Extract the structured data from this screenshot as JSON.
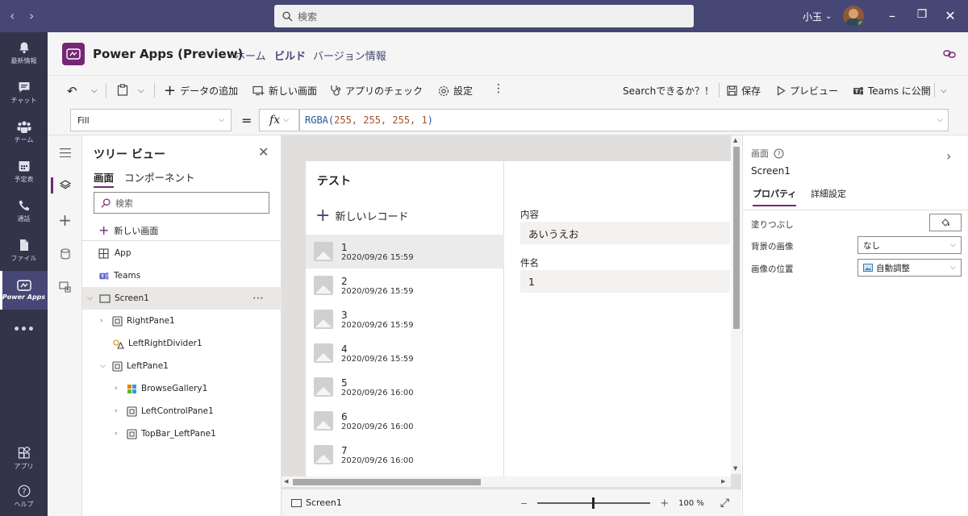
{
  "topbar": {
    "search_placeholder": "検索",
    "user_name": "小玉",
    "user_chevron": "⌄"
  },
  "rail": {
    "items": [
      {
        "label": "最新情報",
        "icon": "bell-icon"
      },
      {
        "label": "チャット",
        "icon": "chat-icon"
      },
      {
        "label": "チーム",
        "icon": "teams-icon"
      },
      {
        "label": "予定表",
        "icon": "calendar-icon"
      },
      {
        "label": "通話",
        "icon": "phone-icon"
      },
      {
        "label": "ファイル",
        "icon": "file-icon"
      },
      {
        "label": "Power Apps",
        "icon": "powerapps-icon"
      },
      {
        "label": "アプリ",
        "icon": "apps-icon"
      },
      {
        "label": "ヘルプ",
        "icon": "help-icon"
      }
    ]
  },
  "app": {
    "title": "Power Apps (Preview)",
    "tabs": [
      "ホーム",
      "ビルド",
      "バージョン情報"
    ]
  },
  "commands": {
    "add_data": "データの追加",
    "new_screen": "新しい画面",
    "app_check": "アプリのチェック",
    "settings": "設定",
    "search_q": "Searchできるか？！",
    "save": "保存",
    "preview": "プレビュー",
    "publish": "Teams に公開"
  },
  "formula": {
    "property": "Fill",
    "eq": "=",
    "fx": "fx",
    "fn": "RGBA(",
    "args": "255, 255, 255, 1",
    "close": ")"
  },
  "tree": {
    "title": "ツリー ビュー",
    "tabs": [
      "画面",
      "コンポーネント"
    ],
    "search_placeholder": "検索",
    "new_screen": "新しい画面",
    "nodes": [
      {
        "label": "App"
      },
      {
        "label": "Teams"
      },
      {
        "label": "Screen1"
      },
      {
        "label": "RightPane1"
      },
      {
        "label": "LeftRightDivider1"
      },
      {
        "label": "LeftPane1"
      },
      {
        "label": "BrowseGallery1"
      },
      {
        "label": "LeftControlPane1"
      },
      {
        "label": "TopBar_LeftPane1"
      }
    ]
  },
  "canvas": {
    "left_title": "テスト",
    "new_record": "新しいレコード",
    "gallery": [
      {
        "num": "1",
        "date": "2020/09/26 15:59"
      },
      {
        "num": "2",
        "date": "2020/09/26 15:59"
      },
      {
        "num": "3",
        "date": "2020/09/26 15:59"
      },
      {
        "num": "4",
        "date": "2020/09/26 15:59"
      },
      {
        "num": "5",
        "date": "2020/09/26 16:00"
      },
      {
        "num": "6",
        "date": "2020/09/26 16:00"
      },
      {
        "num": "7",
        "date": "2020/09/26 16:00"
      }
    ],
    "detail": {
      "content_label": "内容",
      "content_value": "あいうえお",
      "subject_label": "件名",
      "subject_value": "1"
    }
  },
  "bottom": {
    "screen": "Screen1",
    "zoom_minus": "−",
    "zoom_plus": "+",
    "zoom": "100 %"
  },
  "right": {
    "type": "画面",
    "name": "Screen1",
    "tabs": [
      "プロパティ",
      "詳細設定"
    ],
    "props": {
      "fill_label": "塗りつぶし",
      "bgimage_label": "背景の画像",
      "bgimage_value": "なし",
      "imgpos_label": "画像の位置",
      "imgpos_value": "自動調整"
    }
  },
  "colors": {
    "teams_header": "#464775",
    "rail": "#33344a",
    "powerapps_accent": "#742774"
  }
}
